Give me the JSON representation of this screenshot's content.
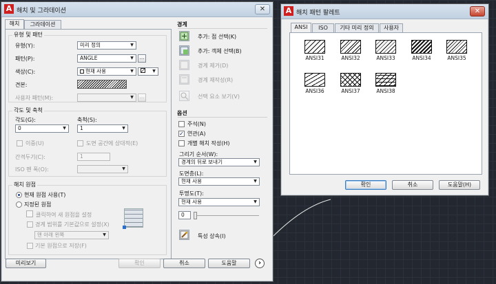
{
  "hatch_dialog": {
    "title": "해치 및 그라데이션",
    "tabs": [
      "해치",
      "그라데이션"
    ],
    "type_pattern": {
      "group": "유형 및 패턴",
      "type_label": "유형(Y):",
      "type_value": "미리 정의",
      "pattern_label": "패턴(P):",
      "pattern_value": "ANGLE",
      "color_label": "색상(C):",
      "color_value": "현재 사용",
      "swatch_label": "견본:",
      "custom_label": "사용자 패턴(M):",
      "browse": "..."
    },
    "angle_scale": {
      "group": "각도 및 축척",
      "angle_label": "각도(G):",
      "angle_value": "0",
      "scale_label": "축척(S):",
      "scale_value": "1",
      "double_label": "이중(U)",
      "relative_label": "도면 공간에 상대적(E)",
      "spacing_label": "간격두기(C):",
      "spacing_value": "1",
      "iso_label": "ISO 펜 폭(O):"
    },
    "origin": {
      "group": "해치 원점",
      "use_current": "현재 원점 사용(T)",
      "specified": "지정된 원점",
      "click_set": "클릭하여 새 원점을 설정",
      "default_extents": "경계 범위를 기본값으로 설정(X)",
      "position_value": "맨 아래 왼쪽",
      "store_default": "기본 원점으로 저장(F)"
    },
    "boundaries": {
      "group": "경계",
      "add_pick": "추가: 점 선택(K)",
      "add_select": "추가: 객체 선택(B)",
      "remove": "경계 제거(D)",
      "recreate": "경계 재작성(R)",
      "view": "선택 요소 보기(V)"
    },
    "options": {
      "group": "옵션",
      "annotative": "주석(N)",
      "associative": "연관(A)",
      "separate": "개별 해치 작성(H)",
      "draw_order_label": "그리기 순서(W):",
      "draw_order_value": "경계의 뒤로 보내기",
      "layer_label": "도면층(L):",
      "layer_value": "현재 사용",
      "transparency_label": "투명도(T):",
      "transparency_value": "현재 사용",
      "transparency_number": "0",
      "inherit": "특성 상속(I)"
    },
    "buttons": {
      "preview": "미리보기",
      "ok": "확인",
      "cancel": "취소",
      "help": "도움말",
      "more": "›"
    }
  },
  "palette": {
    "title": "해치 패턴 팔레트",
    "tabs": [
      "ANSI",
      "ISO",
      "기타 미리 정의",
      "사용자"
    ],
    "patterns": [
      "ANSI31",
      "ANSI32",
      "ANSI33",
      "ANSI34",
      "ANSI35",
      "ANSI36",
      "ANSI37",
      "ANSI38"
    ],
    "buttons": {
      "ok": "확인",
      "cancel": "취소",
      "help": "도움말(H)"
    }
  },
  "close_glyph": "✕",
  "app_glyph": "A",
  "colors": {
    "canvas": "#232830",
    "dialog": "#f0f0f0",
    "titlebar": "#c8d6e5",
    "app_icon": "#d01f1f"
  }
}
